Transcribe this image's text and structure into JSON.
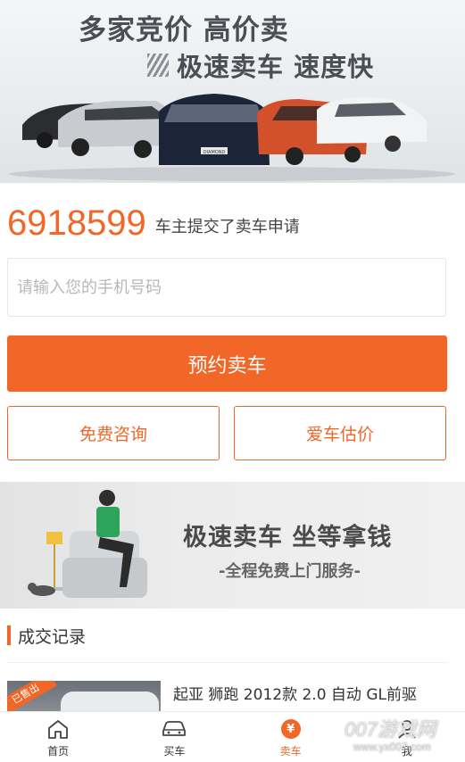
{
  "banner": {
    "line1": "多家竞价 高价卖",
    "line2": "极速卖车 速度快",
    "plate_labels": [
      "DIAMOND"
    ]
  },
  "stats": {
    "count": "6918599",
    "suffix": "车主提交了卖车申请"
  },
  "form": {
    "phone_placeholder": "请输入您的手机号码",
    "phone_value": "",
    "submit_label": "预约卖车",
    "consult_label": "免费咨询",
    "valuation_label": "爱车估价"
  },
  "promo": {
    "title": "极速卖车 坐等拿钱",
    "subtitle": "-全程免费上门服务-"
  },
  "records": {
    "title": "成交记录",
    "items": [
      {
        "tag": "已售出",
        "title": "起亚 狮跑 2012款 2.0 自动 GL前驱"
      }
    ]
  },
  "tabbar": {
    "items": [
      {
        "label": "首页",
        "icon": "home-icon",
        "active": false
      },
      {
        "label": "买车",
        "icon": "car-icon",
        "active": false
      },
      {
        "label": "卖车",
        "icon": "yen-icon",
        "active": true
      },
      {
        "label": "我",
        "icon": "user-icon",
        "active": false
      }
    ]
  },
  "watermark": {
    "text": "007游戏网",
    "url": "www.yx007.com"
  },
  "colors": {
    "accent": "#f26628",
    "text": "#333333",
    "placeholder": "#b8b8b8"
  }
}
